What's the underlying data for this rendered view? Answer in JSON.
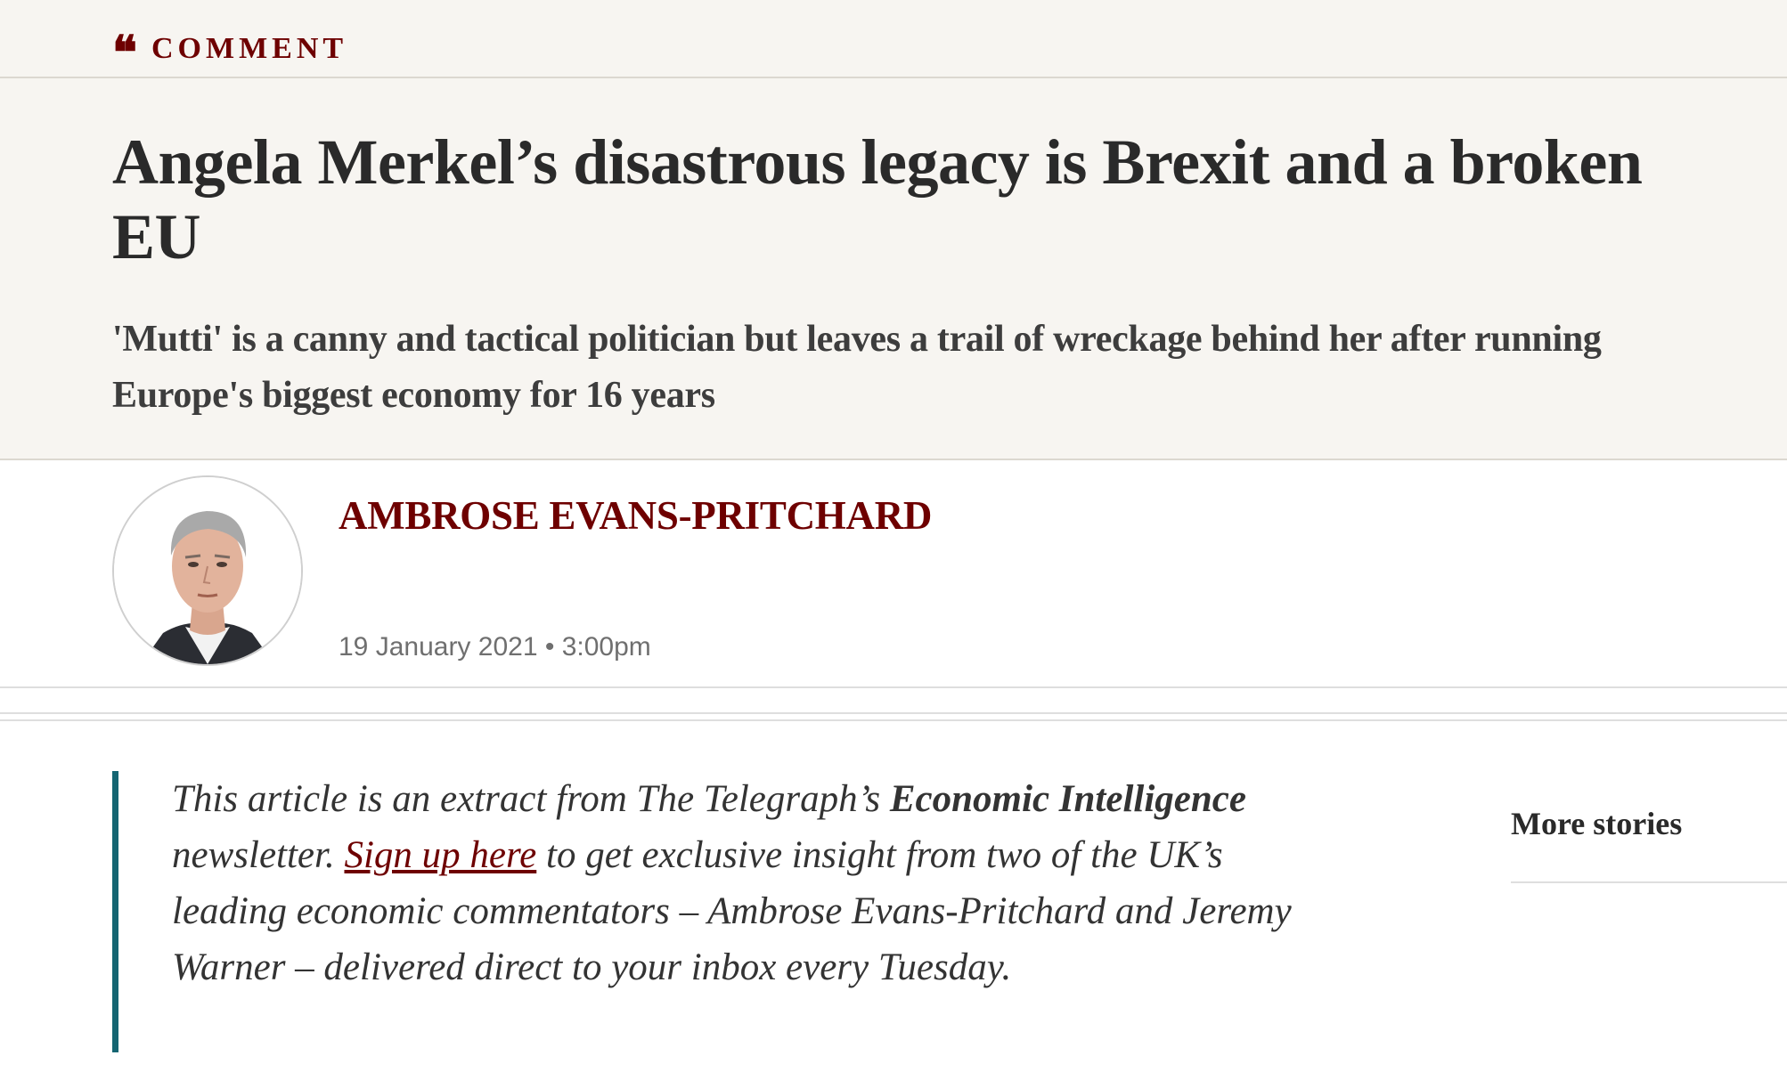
{
  "section": {
    "icon": "quote-mark-icon",
    "label": "COMMENT",
    "accent_color": "#6e0000"
  },
  "article": {
    "headline": "Angela Merkel’s disastrous legacy is Brexit and a broken EU",
    "standfirst": "'Mutti' is a canny and tactical politician but leaves a trail of wreckage behind her after running Europe's biggest economy for 16 years",
    "author": "AMBROSE EVANS-PRITCHARD",
    "date": "19 January 2021",
    "separator": "•",
    "time": "3:00pm"
  },
  "extract": {
    "text_1": "This article is an extract from The Telegraph’s ",
    "newsletter_name": "Economic Intelligence",
    "text_2": " newsletter. ",
    "signup_link": "Sign up here",
    "text_3": " to get exclusive insight from two of the UK’s leading economic commentators – Ambrose Evans-Pritchard and Jeremy Warner – delivered direct to your inbox every Tuesday.",
    "border_color": "#146572"
  },
  "sidebar": {
    "more_stories": "More stories"
  }
}
